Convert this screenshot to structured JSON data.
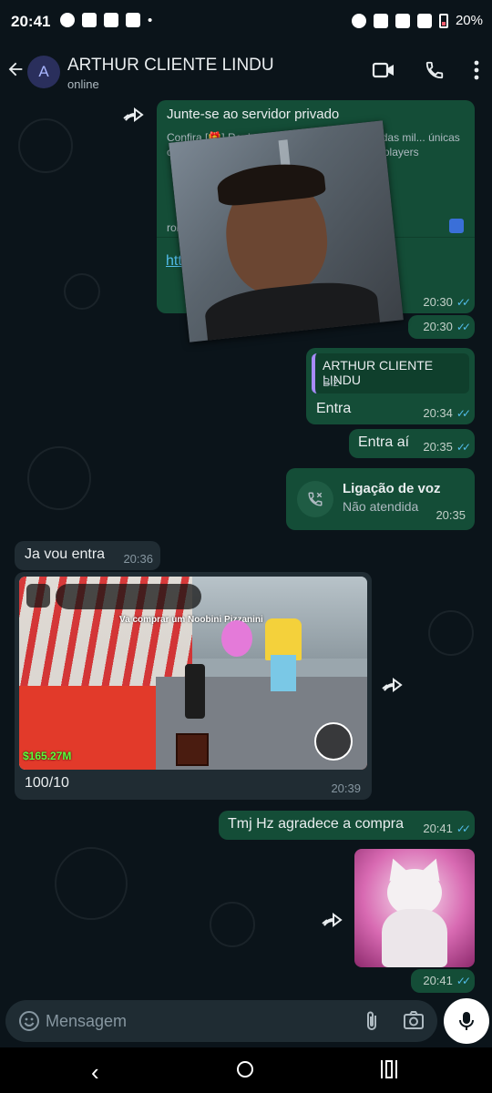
{
  "status_bar": {
    "time": "20:41",
    "battery": "20%"
  },
  "header": {
    "avatar_letter": "A",
    "contact_name": "ARTHUR CLIENTE LINDU",
    "contact_status": "online"
  },
  "messages": {
    "link_card": {
      "title": "Junte-se ao servidor privado",
      "description": "Confira [🎁] Roube um B... periência é uma das mil... únicas criadas P... teal a Brainrot! B... to Play: G... r players",
      "site": "rob",
      "link_text": "htt... de= a36... f0d50& type",
      "time": "20:30"
    },
    "link_footer_time": "20:30",
    "reply": {
      "quoted_name": "ARTHUR CLIENTE LINDU",
      "quoted_text": "Blz",
      "text": "Entra",
      "time": "20:34"
    },
    "entra_ai": {
      "text": "Entra aí",
      "time": "20:35"
    },
    "voice_call": {
      "title": "Ligação de voz",
      "subtitle": "Não atendida",
      "time": "20:35"
    },
    "ja_vou": {
      "text": "Ja vou entra",
      "time": "20:36"
    },
    "game_image": {
      "overlay_title": "Va comprar um Noobini Pizzanini",
      "money": "$165.27M",
      "caption": "100/10",
      "time": "20:39"
    },
    "tmj": {
      "text": "Tmj Hz agradece a compra",
      "time": "20:41"
    },
    "cat_sticker": {
      "time": "20:41"
    }
  },
  "input": {
    "placeholder": "Mensagem"
  },
  "colors": {
    "outgoing_bubble": "#144d37",
    "incoming_bubble": "#202c33",
    "background": "#0b141a",
    "read_ticks": "#53bdeb"
  },
  "icons": [
    "back-arrow-icon",
    "video-call-icon",
    "phone-icon",
    "more-vert-icon",
    "forward-icon",
    "missed-call-icon",
    "emoji-icon",
    "attach-icon",
    "camera-icon",
    "mic-icon"
  ]
}
